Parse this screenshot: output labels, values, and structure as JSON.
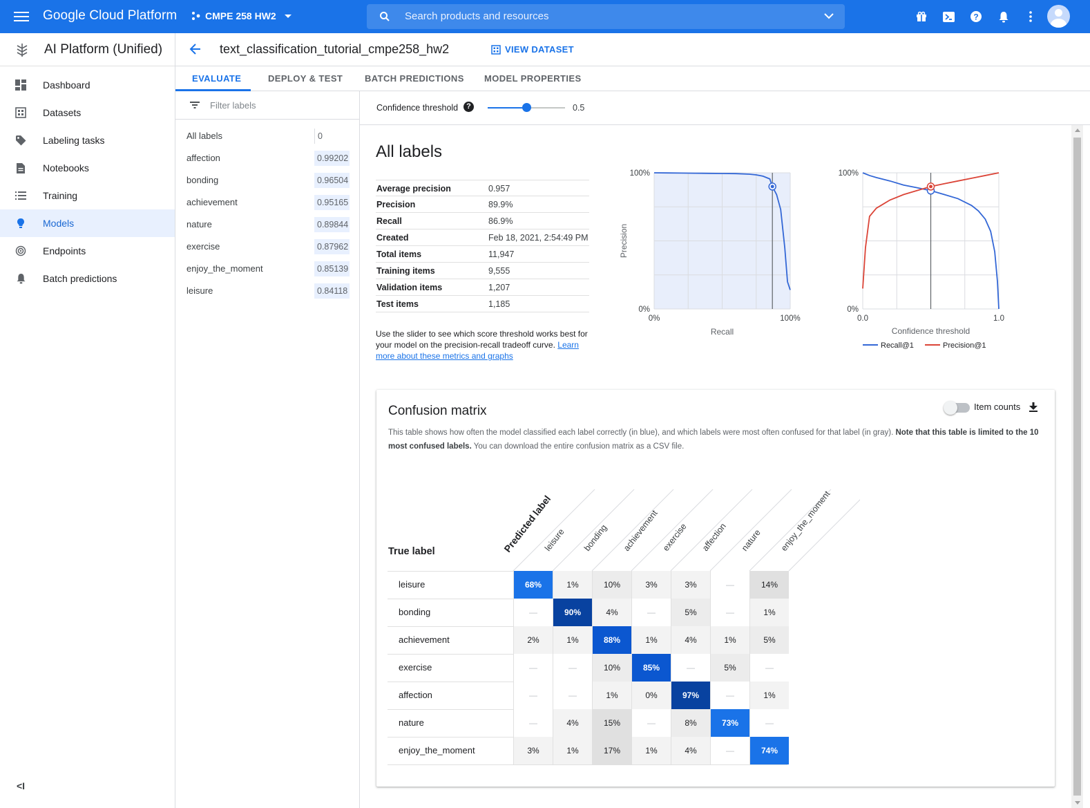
{
  "topbar": {
    "brand": "Google Cloud Platform",
    "project": "CMPE 258 HW2",
    "search_placeholder": "Search products and resources",
    "icons": [
      "gift-icon",
      "cloud-shell-icon",
      "help-icon",
      "notifications-icon",
      "more-vert-icon",
      "avatar"
    ]
  },
  "nav": {
    "product": "AI Platform (Unified)",
    "items": [
      {
        "label": "Dashboard",
        "icon": "dashboard-icon"
      },
      {
        "label": "Datasets",
        "icon": "datasets-icon"
      },
      {
        "label": "Labeling tasks",
        "icon": "label-icon"
      },
      {
        "label": "Notebooks",
        "icon": "notebook-icon"
      },
      {
        "label": "Training",
        "icon": "list-icon"
      },
      {
        "label": "Models",
        "icon": "lightbulb-icon",
        "active": true
      },
      {
        "label": "Endpoints",
        "icon": "endpoint-icon"
      },
      {
        "label": "Batch predictions",
        "icon": "bell-icon"
      }
    ],
    "collapse": "<I"
  },
  "header": {
    "title": "text_classification_tutorial_cmpe258_hw2",
    "view_dataset": "VIEW DATASET"
  },
  "tabs": [
    "EVALUATE",
    "DEPLOY & TEST",
    "BATCH PREDICTIONS",
    "MODEL PROPERTIES"
  ],
  "filter": {
    "placeholder": "Filter labels",
    "labels": [
      {
        "name": "All labels",
        "value": "0"
      },
      {
        "name": "affection",
        "value": "0.99202"
      },
      {
        "name": "bonding",
        "value": "0.96504"
      },
      {
        "name": "achievement",
        "value": "0.95165"
      },
      {
        "name": "nature",
        "value": "0.89844"
      },
      {
        "name": "exercise",
        "value": "0.87962"
      },
      {
        "name": "enjoy_the_moment",
        "value": "0.85139"
      },
      {
        "name": "leisure",
        "value": "0.84118"
      }
    ]
  },
  "threshold": {
    "label": "Confidence threshold",
    "value": "0.5",
    "fraction": 0.5
  },
  "summary": {
    "title": "All labels",
    "metrics": [
      {
        "k": "Average precision",
        "v": "0.957"
      },
      {
        "k": "Precision",
        "v": "89.9%"
      },
      {
        "k": "Recall",
        "v": "86.9%"
      },
      {
        "k": "Created",
        "v": "Feb 18, 2021, 2:54:49 PM"
      },
      {
        "k": "Total items",
        "v": "11,947"
      },
      {
        "k": "Training items",
        "v": "9,555"
      },
      {
        "k": "Validation items",
        "v": "1,207"
      },
      {
        "k": "Test items",
        "v": "1,185"
      }
    ],
    "hint_text": "Use the slider to see which score threshold works best for your model on the precision-recall tradeoff curve.",
    "hint_link": "Learn more about these metrics and graphs"
  },
  "chart_data": [
    {
      "type": "line",
      "xlabel": "Recall",
      "ylabel": "Precision",
      "xticks": [
        "0%",
        "100%"
      ],
      "yticks": [
        "0%",
        "100%"
      ],
      "xlim": [
        0,
        1
      ],
      "ylim": [
        0,
        1
      ],
      "grid": true,
      "series": [
        {
          "x": [
            0,
            0.1,
            0.2,
            0.3,
            0.4,
            0.5,
            0.6,
            0.7,
            0.75,
            0.8,
            0.85,
            0.869,
            0.9,
            0.93,
            0.96,
            0.98,
            1.0
          ],
          "y": [
            1.0,
            0.999,
            0.998,
            0.997,
            0.996,
            0.995,
            0.994,
            0.99,
            0.985,
            0.975,
            0.955,
            0.899,
            0.84,
            0.73,
            0.45,
            0.2,
            0.14
          ]
        }
      ],
      "marker": {
        "x": 0.869,
        "y": 0.899
      }
    },
    {
      "type": "line",
      "xlabel": "Confidence threshold",
      "xticks": [
        "0.0",
        "1.0"
      ],
      "yticks": [
        "0%",
        "100%"
      ],
      "xlim": [
        0,
        1
      ],
      "ylim": [
        0,
        1
      ],
      "grid": true,
      "legend": "bottom",
      "series": [
        {
          "name": "Recall@1",
          "color": "#3367d6",
          "x": [
            0,
            0.05,
            0.1,
            0.2,
            0.3,
            0.4,
            0.5,
            0.6,
            0.7,
            0.8,
            0.85,
            0.9,
            0.94,
            0.97,
            0.99,
            1.0
          ],
          "y": [
            1.0,
            0.98,
            0.965,
            0.94,
            0.91,
            0.89,
            0.869,
            0.84,
            0.81,
            0.76,
            0.72,
            0.66,
            0.57,
            0.42,
            0.2,
            0.0
          ]
        },
        {
          "name": "Precision@1",
          "color": "#db4437",
          "x": [
            0,
            0.02,
            0.05,
            0.1,
            0.15,
            0.2,
            0.3,
            0.4,
            0.5,
            0.6,
            0.7,
            0.8,
            0.9,
            1.0
          ],
          "y": [
            0.15,
            0.45,
            0.68,
            0.74,
            0.77,
            0.8,
            0.84,
            0.87,
            0.899,
            0.92,
            0.94,
            0.96,
            0.98,
            1.0
          ]
        }
      ],
      "marker": {
        "x": 0.5,
        "y": 0.885
      }
    }
  ],
  "confusion": {
    "title": "Confusion matrix",
    "item_counts": "Item counts",
    "desc_pre": "This table shows how often the model classified each label correctly (in blue), and which labels were most often confused for that label (in gray).",
    "desc_bold": "Note that this table is limited to the 10 most confused labels.",
    "desc_post": "You can download the entire confusion matrix as a CSV file.",
    "predicted_label": "Predicted label",
    "true_label": "True label",
    "columns": [
      "leisure",
      "bonding",
      "achievement",
      "exercise",
      "affection",
      "nature",
      "enjoy_the_moment"
    ],
    "rows": [
      {
        "name": "leisure",
        "cells": [
          "68%",
          "1%",
          "10%",
          "3%",
          "3%",
          "—",
          "14%"
        ]
      },
      {
        "name": "bonding",
        "cells": [
          "—",
          "90%",
          "4%",
          "—",
          "5%",
          "—",
          "1%"
        ]
      },
      {
        "name": "achievement",
        "cells": [
          "2%",
          "1%",
          "88%",
          "1%",
          "4%",
          "1%",
          "5%"
        ]
      },
      {
        "name": "exercise",
        "cells": [
          "—",
          "—",
          "10%",
          "85%",
          "—",
          "5%",
          "—"
        ]
      },
      {
        "name": "affection",
        "cells": [
          "—",
          "—",
          "1%",
          "0%",
          "97%",
          "—",
          "1%"
        ]
      },
      {
        "name": "nature",
        "cells": [
          "—",
          "4%",
          "15%",
          "—",
          "8%",
          "73%",
          "—"
        ]
      },
      {
        "name": "enjoy_the_moment",
        "cells": [
          "3%",
          "1%",
          "17%",
          "1%",
          "4%",
          "—",
          "74%"
        ]
      }
    ]
  }
}
